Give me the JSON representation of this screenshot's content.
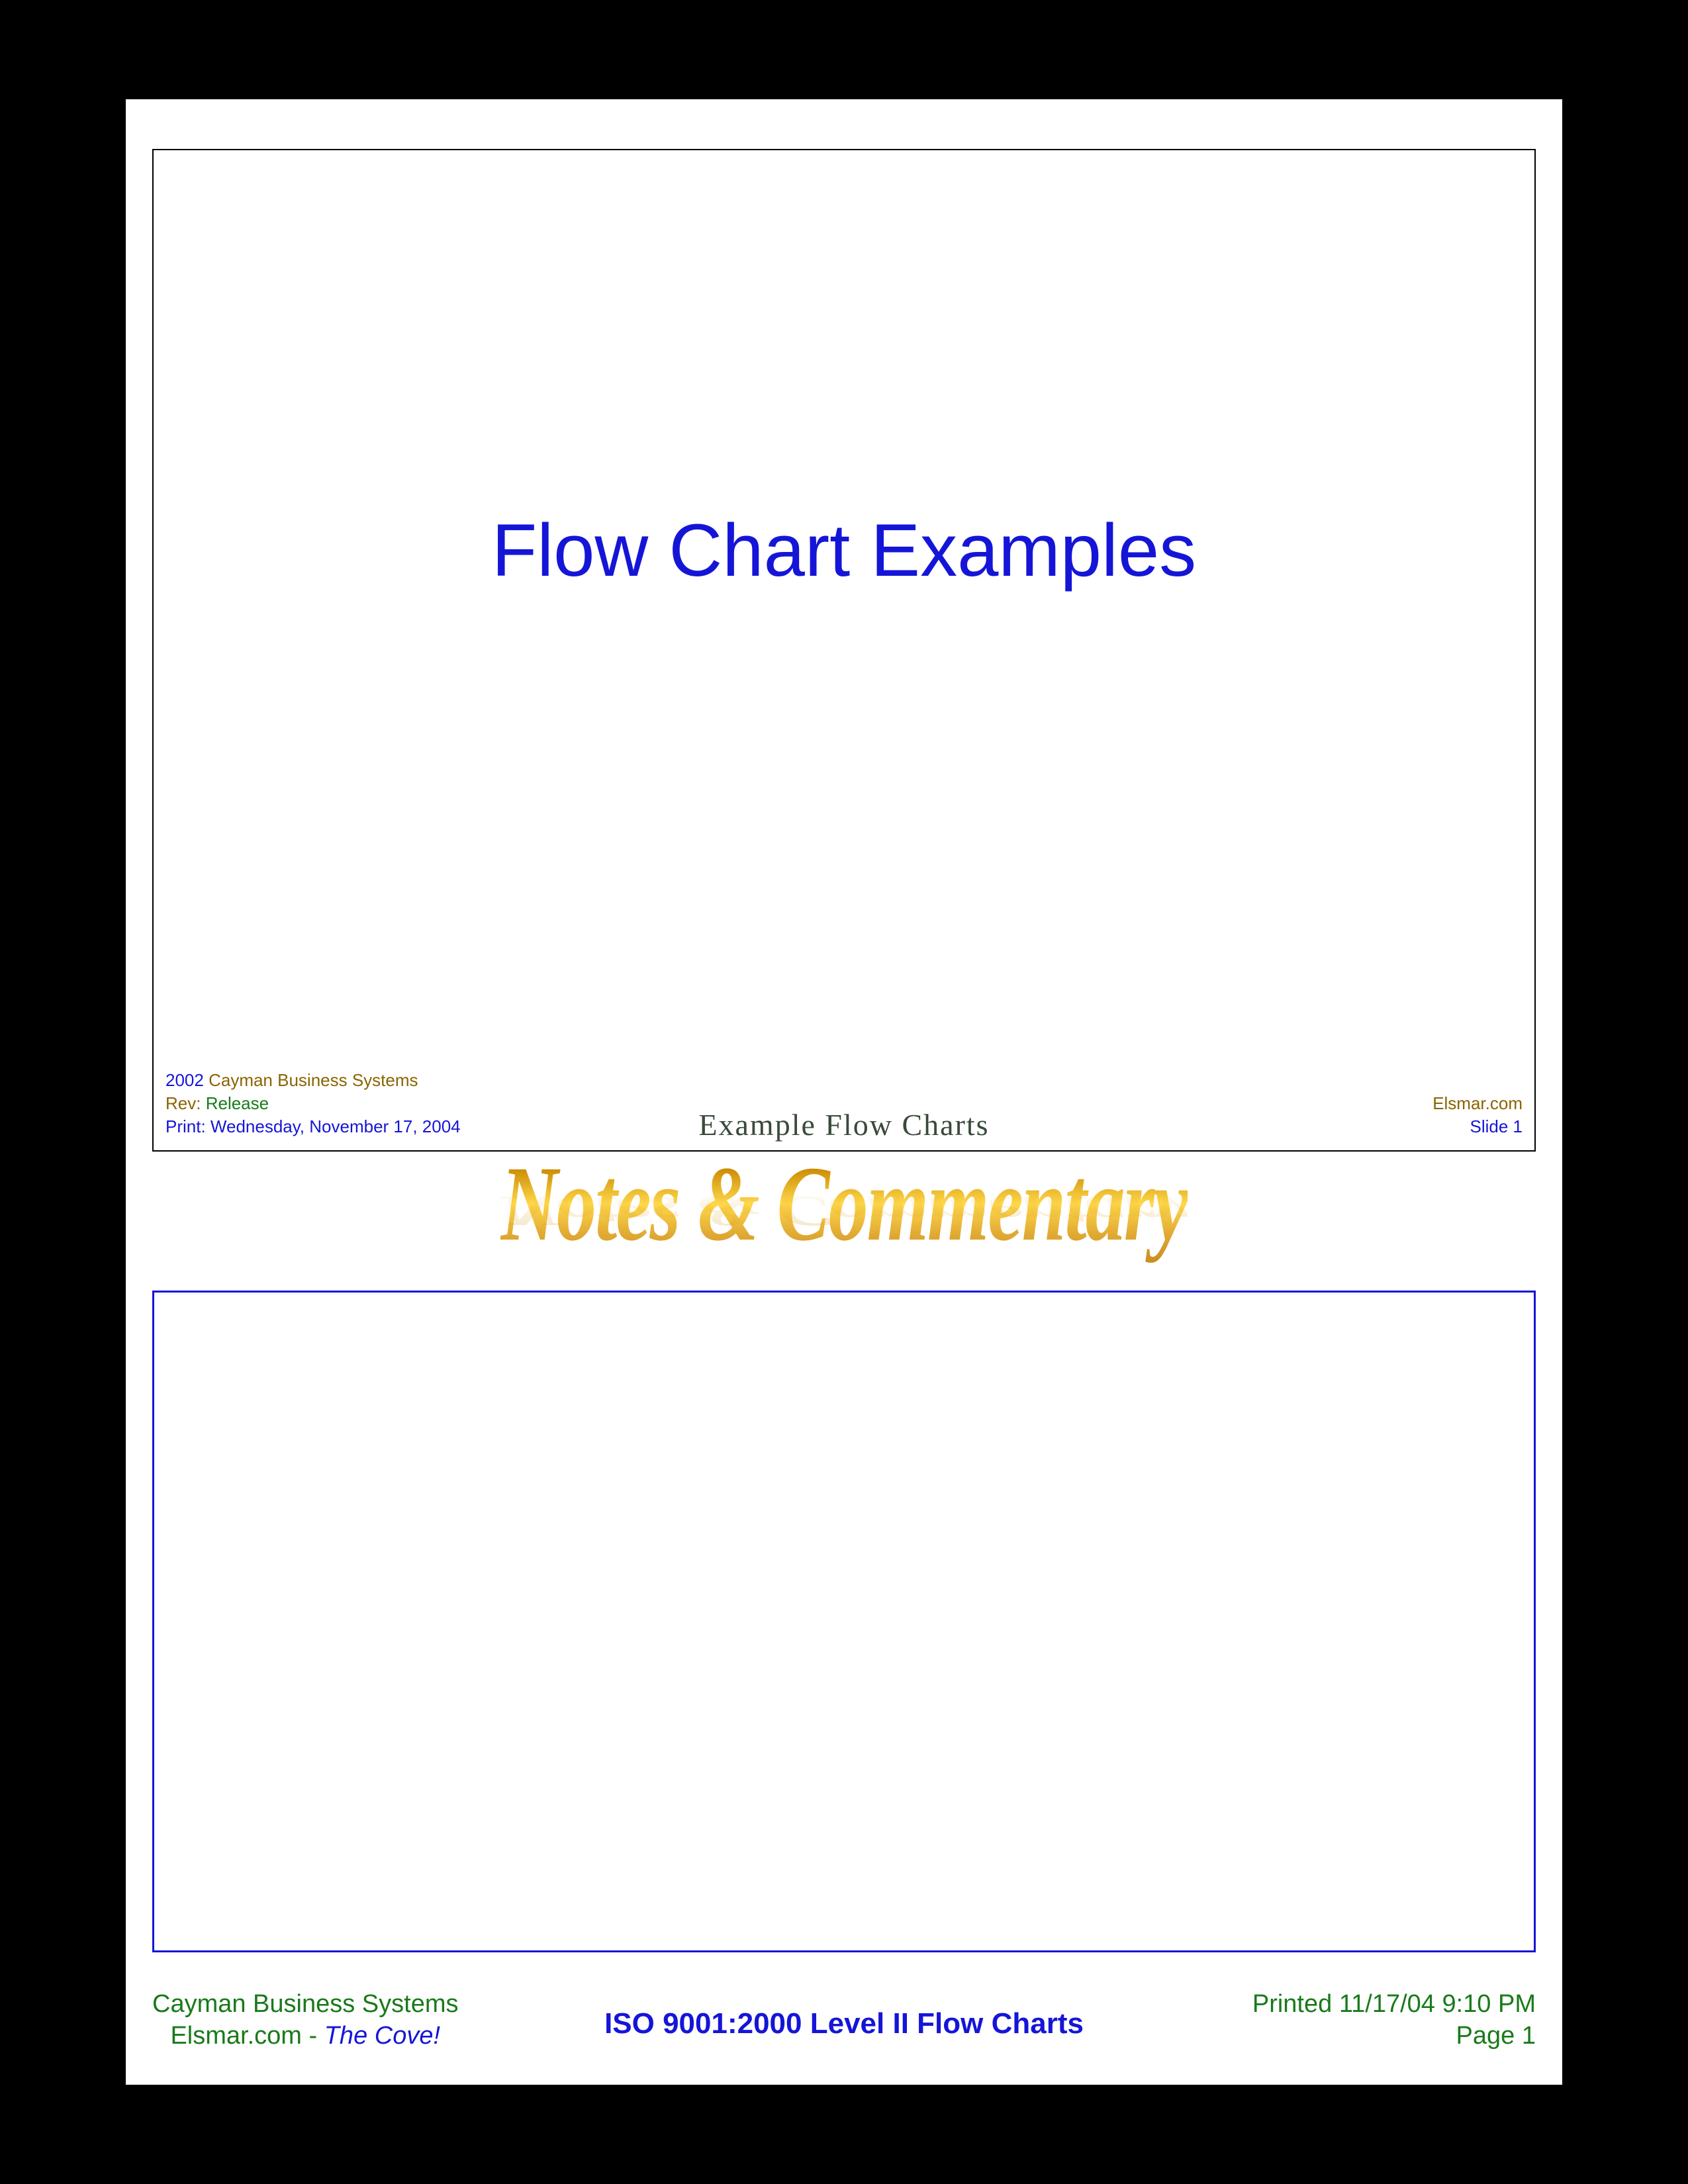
{
  "slide": {
    "title": "Flow Chart Examples",
    "subtitle": "Example Flow Charts",
    "copyright_year": "2002",
    "copyright_company": "Cayman Business Systems",
    "rev_label": "Rev:",
    "rev_value": "Release",
    "print_line": "Print: Wednesday, November 17, 2004",
    "site": "Elsmar.com",
    "slide_label": "Slide  1"
  },
  "notes": {
    "heading": "Notes & Commentary"
  },
  "footer": {
    "company": "Cayman Business Systems",
    "site": "Elsmar.com",
    "separator": " - ",
    "tagline": "The Cove!",
    "center_title": "ISO 9001:2000 Level II Flow Charts",
    "printed": "Printed 11/17/04 9:10 PM",
    "page": "Page 1"
  }
}
